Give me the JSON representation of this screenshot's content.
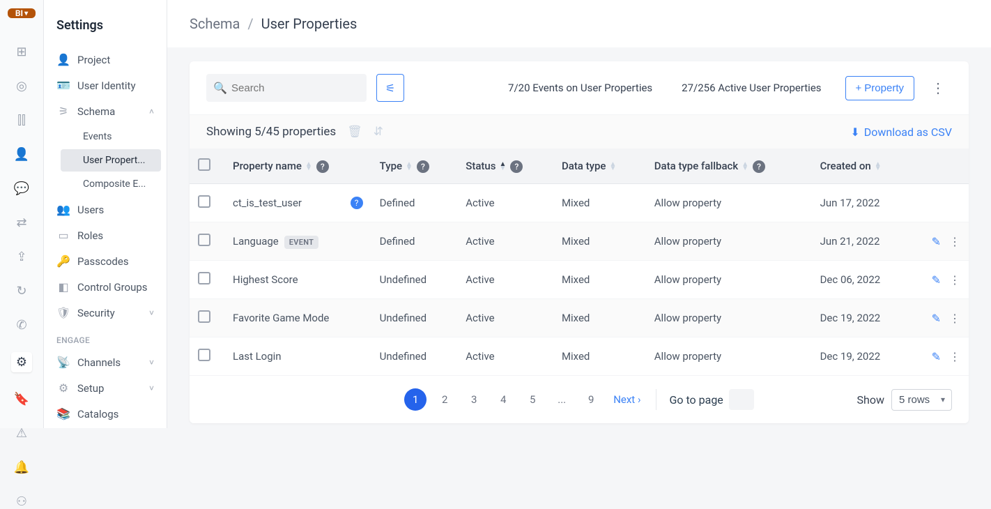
{
  "logo": {
    "text": "BI"
  },
  "sidebar": {
    "title": "Settings",
    "items": [
      {
        "label": "Project",
        "icon_name": "user-icon"
      },
      {
        "label": "User Identity",
        "icon_name": "id-card-icon"
      },
      {
        "label": "Schema",
        "icon_name": "schema-icon",
        "expanded": true,
        "children": [
          {
            "label": "Events"
          },
          {
            "label": "User Propert...",
            "active": true
          },
          {
            "label": "Composite E..."
          }
        ]
      },
      {
        "label": "Users",
        "icon_name": "users-icon"
      },
      {
        "label": "Roles",
        "icon_name": "roles-icon"
      },
      {
        "label": "Passcodes",
        "icon_name": "passcode-icon"
      },
      {
        "label": "Control Groups",
        "icon_name": "control-icon"
      },
      {
        "label": "Security",
        "icon_name": "shield-icon",
        "chevron": true
      }
    ],
    "section_label": "ENGAGE",
    "engage_items": [
      {
        "label": "Channels",
        "icon_name": "channels-icon",
        "chevron": true
      },
      {
        "label": "Setup",
        "icon_name": "setup-icon",
        "chevron": true
      },
      {
        "label": "Catalogs",
        "icon_name": "catalogs-icon"
      }
    ]
  },
  "breadcrumb": {
    "parent": "Schema",
    "current": "User Properties"
  },
  "toolbar": {
    "search_placeholder": "Search",
    "stat1": "7/20 Events on User Properties",
    "stat2": "27/256 Active User Properties",
    "add_label": "Property"
  },
  "subbar": {
    "showing": "Showing 5/45 properties",
    "download": "Download as CSV"
  },
  "table": {
    "headers": {
      "name": "Property name",
      "type": "Type",
      "status": "Status",
      "data_type": "Data type",
      "fallback": "Data type fallback",
      "created": "Created on"
    },
    "rows": [
      {
        "name": "ct_is_test_user",
        "tag": "",
        "type": "Defined",
        "status": "Active",
        "data_type": "Mixed",
        "fallback": "Allow property",
        "created": "Jun 17, 2022",
        "info": true,
        "actions": false
      },
      {
        "name": "Language",
        "tag": "EVENT",
        "type": "Defined",
        "status": "Active",
        "data_type": "Mixed",
        "fallback": "Allow property",
        "created": "Jun 21, 2022",
        "info": false,
        "actions": true
      },
      {
        "name": "Highest Score",
        "tag": "",
        "type": "Undefined",
        "status": "Active",
        "data_type": "Mixed",
        "fallback": "Allow property",
        "created": "Dec 06, 2022",
        "info": false,
        "actions": true
      },
      {
        "name": "Favorite Game Mode",
        "tag": "",
        "type": "Undefined",
        "status": "Active",
        "data_type": "Mixed",
        "fallback": "Allow property",
        "created": "Dec 19, 2022",
        "info": false,
        "actions": true
      },
      {
        "name": "Last Login",
        "tag": "",
        "type": "Undefined",
        "status": "Active",
        "data_type": "Mixed",
        "fallback": "Allow property",
        "created": "Dec 19, 2022",
        "info": false,
        "actions": true
      }
    ]
  },
  "pagination": {
    "pages": [
      "1",
      "2",
      "3",
      "4",
      "5",
      "...",
      "9"
    ],
    "next": "Next",
    "goto_label": "Go to page",
    "show_label": "Show",
    "rows_label": "5 rows"
  }
}
